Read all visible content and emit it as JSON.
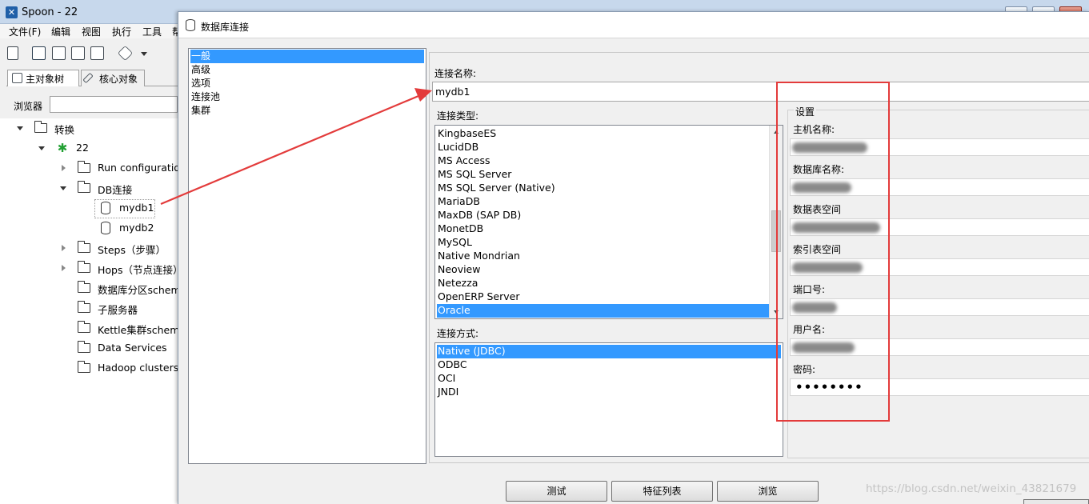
{
  "main": {
    "title": "Spoon - 22",
    "menu": [
      "文件(F)",
      "编辑",
      "视图",
      "执行",
      "工具",
      "帮"
    ],
    "tabs": [
      "主对象树",
      "核心对象"
    ],
    "browser_label": "浏览器",
    "tree": {
      "root": "转换",
      "trans": "22",
      "run_config": "Run configuration",
      "db_folder": "DB连接",
      "db1": "mydb1",
      "db2": "mydb2",
      "steps": "Steps（步骤）",
      "hops": "Hops（节点连接）",
      "partition": "数据库分区schem",
      "slave": "子服务器",
      "cluster": "Kettle集群schema",
      "data_services": "Data Services",
      "hadoop": "Hadoop clusters"
    }
  },
  "dialog": {
    "title": "数据库连接",
    "categories": [
      "一般",
      "高级",
      "选项",
      "连接池",
      "集群"
    ],
    "conn_name_label": "连接名称:",
    "conn_name_value": "mydb1",
    "conn_type_label": "连接类型:",
    "conn_types": [
      "KingbaseES",
      "LucidDB",
      "MS Access",
      "MS SQL Server",
      "MS SQL Server (Native)",
      "MariaDB",
      "MaxDB (SAP DB)",
      "MonetDB",
      "MySQL",
      "Native Mondrian",
      "Neoview",
      "Netezza",
      "OpenERP Server",
      "Oracle"
    ],
    "conn_method_label": "连接方式:",
    "conn_methods": [
      "Native (JDBC)",
      "ODBC",
      "OCI",
      "JNDI"
    ],
    "settings": {
      "legend": "设置",
      "host_label": "主机名称:",
      "dbname_label": "数据库名称:",
      "tablespace_label": "数据表空间",
      "index_label": "索引表空间",
      "port_label": "端口号:",
      "user_label": "用户名:",
      "password_label": "密码:",
      "password_value": "••••••••"
    },
    "buttons": {
      "test": "测试",
      "features": "特征列表",
      "browse": "浏览"
    }
  },
  "watermark": "https://blog.csdn.net/weixin_43821679",
  "colors": {
    "selection": "#3399ff",
    "annotation": "#e33b3b"
  }
}
